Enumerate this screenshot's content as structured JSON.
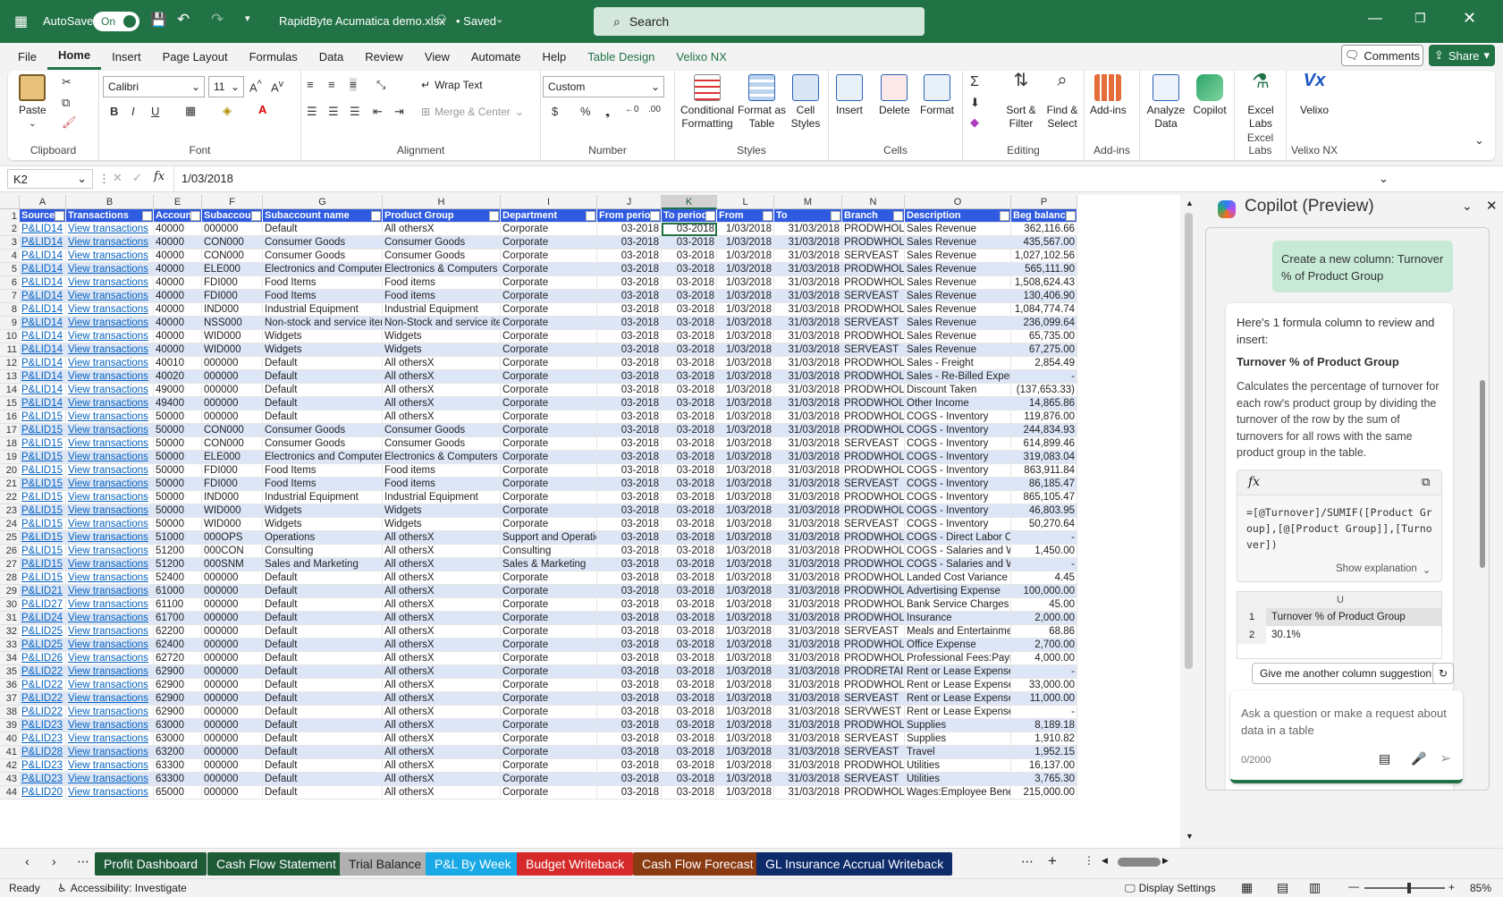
{
  "titlebar": {
    "autosave_label": "AutoSave",
    "toggle_label": "On",
    "filename": "RapidByte Acumatica demo.xlsx",
    "saved": "• Saved",
    "search_placeholder": "Search"
  },
  "menu": [
    "File",
    "Home",
    "Insert",
    "Page Layout",
    "Formulas",
    "Data",
    "Review",
    "View",
    "Automate",
    "Help",
    "Table Design",
    "Velixo NX"
  ],
  "menu_right": {
    "comments": "Comments",
    "share": "Share"
  },
  "ribbon": {
    "clipboard": {
      "paste": "Paste",
      "label": "Clipboard"
    },
    "font": {
      "name": "Calibri",
      "size": "11",
      "label": "Font"
    },
    "alignment": {
      "wrap": "Wrap Text",
      "merge": "Merge & Center",
      "label": "Alignment"
    },
    "number": {
      "format": "Custom",
      "label": "Number"
    },
    "styles": {
      "cond": "Conditional Formatting",
      "table": "Format as Table",
      "cell": "Cell Styles",
      "label": "Styles"
    },
    "cells": {
      "insert": "Insert",
      "delete": "Delete",
      "format": "Format",
      "label": "Cells"
    },
    "editing": {
      "sort": "Sort & Filter",
      "find": "Find & Select",
      "label": "Editing"
    },
    "addins": {
      "addins": "Add-ins",
      "label": "Add-ins"
    },
    "analyze": "Analyze Data",
    "copilot": "Copilot",
    "excellabs": {
      "btn": "Excel Labs",
      "label": "Excel Labs"
    },
    "velixo": {
      "btn": "Velixo",
      "label": "Velixo NX"
    }
  },
  "formula_bar": {
    "name_box": "K2",
    "fx": "fx",
    "value": "1/03/2018"
  },
  "columns": [
    "A",
    "B",
    "E",
    "F",
    "G",
    "H",
    "I",
    "J",
    "K",
    "L",
    "M",
    "N",
    "O",
    "P"
  ],
  "headers": [
    "Source",
    "Transactions",
    "Account",
    "Subaccount",
    "Subaccount name",
    "Product Group",
    "Department",
    "From period",
    "To period",
    "From",
    "To",
    "Branch",
    "Description",
    "Beg balance"
  ],
  "rows": [
    [
      "P&LID14",
      "View transactions",
      "40000",
      "000000",
      "Default",
      "All othersX",
      "Corporate",
      "03-2018",
      "03-2018",
      "1/03/2018",
      "31/03/2018",
      "PRODWHOLE",
      "Sales Revenue",
      "362,116.66"
    ],
    [
      "P&LID14",
      "View transactions",
      "40000",
      "CON000",
      "Consumer Goods",
      "Consumer Goods",
      "Corporate",
      "03-2018",
      "03-2018",
      "1/03/2018",
      "31/03/2018",
      "PRODWHOLE",
      "Sales Revenue",
      "435,567.00"
    ],
    [
      "P&LID14",
      "View transactions",
      "40000",
      "CON000",
      "Consumer Goods",
      "Consumer Goods",
      "Corporate",
      "03-2018",
      "03-2018",
      "1/03/2018",
      "31/03/2018",
      "SERVEAST",
      "Sales Revenue",
      "1,027,102.56"
    ],
    [
      "P&LID14",
      "View transactions",
      "40000",
      "ELE000",
      "Electronics and Computers",
      "Electronics & Computers",
      "Corporate",
      "03-2018",
      "03-2018",
      "1/03/2018",
      "31/03/2018",
      "PRODWHOLE",
      "Sales Revenue",
      "565,111.90"
    ],
    [
      "P&LID14",
      "View transactions",
      "40000",
      "FDI000",
      "Food Items",
      "Food items",
      "Corporate",
      "03-2018",
      "03-2018",
      "1/03/2018",
      "31/03/2018",
      "PRODWHOLE",
      "Sales Revenue",
      "1,508,624.43"
    ],
    [
      "P&LID14",
      "View transactions",
      "40000",
      "FDI000",
      "Food Items",
      "Food items",
      "Corporate",
      "03-2018",
      "03-2018",
      "1/03/2018",
      "31/03/2018",
      "SERVEAST",
      "Sales Revenue",
      "130,406.90"
    ],
    [
      "P&LID14",
      "View transactions",
      "40000",
      "IND000",
      "Industrial Equipment",
      "Industrial Equipment",
      "Corporate",
      "03-2018",
      "03-2018",
      "1/03/2018",
      "31/03/2018",
      "PRODWHOLE",
      "Sales Revenue",
      "1,084,774.74"
    ],
    [
      "P&LID14",
      "View transactions",
      "40000",
      "NSS000",
      "Non-stock and service iter",
      "Non-Stock and service ite",
      "Corporate",
      "03-2018",
      "03-2018",
      "1/03/2018",
      "31/03/2018",
      "SERVEAST",
      "Sales Revenue",
      "236,099.64"
    ],
    [
      "P&LID14",
      "View transactions",
      "40000",
      "WID000",
      "Widgets",
      "Widgets",
      "Corporate",
      "03-2018",
      "03-2018",
      "1/03/2018",
      "31/03/2018",
      "PRODWHOLE",
      "Sales Revenue",
      "65,735.00"
    ],
    [
      "P&LID14",
      "View transactions",
      "40000",
      "WID000",
      "Widgets",
      "Widgets",
      "Corporate",
      "03-2018",
      "03-2018",
      "1/03/2018",
      "31/03/2018",
      "SERVEAST",
      "Sales Revenue",
      "67,275.00"
    ],
    [
      "P&LID14",
      "View transactions",
      "40010",
      "000000",
      "Default",
      "All othersX",
      "Corporate",
      "03-2018",
      "03-2018",
      "1/03/2018",
      "31/03/2018",
      "PRODWHOLE",
      "Sales - Freight",
      "2,854.49"
    ],
    [
      "P&LID14",
      "View transactions",
      "40020",
      "000000",
      "Default",
      "All othersX",
      "Corporate",
      "03-2018",
      "03-2018",
      "1/03/2018",
      "31/03/2018",
      "PRODWHOLE",
      "Sales - Re-Billed Expen",
      "-"
    ],
    [
      "P&LID14",
      "View transactions",
      "49000",
      "000000",
      "Default",
      "All othersX",
      "Corporate",
      "03-2018",
      "03-2018",
      "1/03/2018",
      "31/03/2018",
      "PRODWHOLE",
      "Discount Taken",
      "(137,653.33)"
    ],
    [
      "P&LID14",
      "View transactions",
      "49400",
      "000000",
      "Default",
      "All othersX",
      "Corporate",
      "03-2018",
      "03-2018",
      "1/03/2018",
      "31/03/2018",
      "PRODWHOLE",
      "Other Income",
      "14,865.86"
    ],
    [
      "P&LID15",
      "View transactions",
      "50000",
      "000000",
      "Default",
      "All othersX",
      "Corporate",
      "03-2018",
      "03-2018",
      "1/03/2018",
      "31/03/2018",
      "PRODWHOLE",
      "COGS - Inventory",
      "119,876.00"
    ],
    [
      "P&LID15",
      "View transactions",
      "50000",
      "CON000",
      "Consumer Goods",
      "Consumer Goods",
      "Corporate",
      "03-2018",
      "03-2018",
      "1/03/2018",
      "31/03/2018",
      "PRODWHOLE",
      "COGS - Inventory",
      "244,834.93"
    ],
    [
      "P&LID15",
      "View transactions",
      "50000",
      "CON000",
      "Consumer Goods",
      "Consumer Goods",
      "Corporate",
      "03-2018",
      "03-2018",
      "1/03/2018",
      "31/03/2018",
      "SERVEAST",
      "COGS - Inventory",
      "614,899.46"
    ],
    [
      "P&LID15",
      "View transactions",
      "50000",
      "ELE000",
      "Electronics and Computers",
      "Electronics & Computers",
      "Corporate",
      "03-2018",
      "03-2018",
      "1/03/2018",
      "31/03/2018",
      "PRODWHOLE",
      "COGS - Inventory",
      "319,083.04"
    ],
    [
      "P&LID15",
      "View transactions",
      "50000",
      "FDI000",
      "Food Items",
      "Food items",
      "Corporate",
      "03-2018",
      "03-2018",
      "1/03/2018",
      "31/03/2018",
      "PRODWHOLE",
      "COGS - Inventory",
      "863,911.84"
    ],
    [
      "P&LID15",
      "View transactions",
      "50000",
      "FDI000",
      "Food Items",
      "Food items",
      "Corporate",
      "03-2018",
      "03-2018",
      "1/03/2018",
      "31/03/2018",
      "SERVEAST",
      "COGS - Inventory",
      "86,185.47"
    ],
    [
      "P&LID15",
      "View transactions",
      "50000",
      "IND000",
      "Industrial Equipment",
      "Industrial Equipment",
      "Corporate",
      "03-2018",
      "03-2018",
      "1/03/2018",
      "31/03/2018",
      "PRODWHOLE",
      "COGS - Inventory",
      "865,105.47"
    ],
    [
      "P&LID15",
      "View transactions",
      "50000",
      "WID000",
      "Widgets",
      "Widgets",
      "Corporate",
      "03-2018",
      "03-2018",
      "1/03/2018",
      "31/03/2018",
      "PRODWHOLE",
      "COGS - Inventory",
      "46,803.95"
    ],
    [
      "P&LID15",
      "View transactions",
      "50000",
      "WID000",
      "Widgets",
      "Widgets",
      "Corporate",
      "03-2018",
      "03-2018",
      "1/03/2018",
      "31/03/2018",
      "SERVEAST",
      "COGS - Inventory",
      "50,270.64"
    ],
    [
      "P&LID15",
      "View transactions",
      "51000",
      "000OPS",
      "Operations",
      "All othersX",
      "Support and Operatic",
      "03-2018",
      "03-2018",
      "1/03/2018",
      "31/03/2018",
      "PRODWHOLE",
      "COGS - Direct Labor Cos",
      "-"
    ],
    [
      "P&LID15",
      "View transactions",
      "51200",
      "000CON",
      "Consulting",
      "All othersX",
      "Consulting",
      "03-2018",
      "03-2018",
      "1/03/2018",
      "31/03/2018",
      "PRODWHOLE",
      "COGS - Salaries and Wa",
      "1,450.00"
    ],
    [
      "P&LID15",
      "View transactions",
      "51200",
      "000SNM",
      "Sales and Marketing",
      "All othersX",
      "Sales & Marketing",
      "03-2018",
      "03-2018",
      "1/03/2018",
      "31/03/2018",
      "PRODWHOLE",
      "COGS - Salaries and Wa",
      "-"
    ],
    [
      "P&LID15",
      "View transactions",
      "52400",
      "000000",
      "Default",
      "All othersX",
      "Corporate",
      "03-2018",
      "03-2018",
      "1/03/2018",
      "31/03/2018",
      "PRODWHOLE",
      "Landed Cost Variance",
      "4.45"
    ],
    [
      "P&LID21",
      "View transactions",
      "61000",
      "000000",
      "Default",
      "All othersX",
      "Corporate",
      "03-2018",
      "03-2018",
      "1/03/2018",
      "31/03/2018",
      "PRODWHOLE",
      "Advertising Expense",
      "100,000.00"
    ],
    [
      "P&LID27",
      "View transactions",
      "61100",
      "000000",
      "Default",
      "All othersX",
      "Corporate",
      "03-2018",
      "03-2018",
      "1/03/2018",
      "31/03/2018",
      "PRODWHOLE",
      "Bank Service Charges",
      "45.00"
    ],
    [
      "P&LID24",
      "View transactions",
      "61700",
      "000000",
      "Default",
      "All othersX",
      "Corporate",
      "03-2018",
      "03-2018",
      "1/03/2018",
      "31/03/2018",
      "PRODWHOLE",
      "Insurance",
      "2,000.00"
    ],
    [
      "P&LID25",
      "View transactions",
      "62200",
      "000000",
      "Default",
      "All othersX",
      "Corporate",
      "03-2018",
      "03-2018",
      "1/03/2018",
      "31/03/2018",
      "SERVEAST",
      "Meals and Entertainme",
      "68.86"
    ],
    [
      "P&LID25",
      "View transactions",
      "62400",
      "000000",
      "Default",
      "All othersX",
      "Corporate",
      "03-2018",
      "03-2018",
      "1/03/2018",
      "31/03/2018",
      "PRODWHOLE",
      "Office Expense",
      "2,700.00"
    ],
    [
      "P&LID26",
      "View transactions",
      "62720",
      "000000",
      "Default",
      "All othersX",
      "Corporate",
      "03-2018",
      "03-2018",
      "1/03/2018",
      "31/03/2018",
      "PRODWHOLE",
      "Professional Fees:Payr",
      "4,000.00"
    ],
    [
      "P&LID22",
      "View transactions",
      "62900",
      "000000",
      "Default",
      "All othersX",
      "Corporate",
      "03-2018",
      "03-2018",
      "1/03/2018",
      "31/03/2018",
      "PRODRETAIL",
      "Rent or Lease Expense",
      "-"
    ],
    [
      "P&LID22",
      "View transactions",
      "62900",
      "000000",
      "Default",
      "All othersX",
      "Corporate",
      "03-2018",
      "03-2018",
      "1/03/2018",
      "31/03/2018",
      "PRODWHOLE",
      "Rent or Lease Expense",
      "33,000.00"
    ],
    [
      "P&LID22",
      "View transactions",
      "62900",
      "000000",
      "Default",
      "All othersX",
      "Corporate",
      "03-2018",
      "03-2018",
      "1/03/2018",
      "31/03/2018",
      "SERVEAST",
      "Rent or Lease Expense",
      "11,000.00"
    ],
    [
      "P&LID22",
      "View transactions",
      "62900",
      "000000",
      "Default",
      "All othersX",
      "Corporate",
      "03-2018",
      "03-2018",
      "1/03/2018",
      "31/03/2018",
      "SERVWEST",
      "Rent or Lease Expense",
      "-"
    ],
    [
      "P&LID23",
      "View transactions",
      "63000",
      "000000",
      "Default",
      "All othersX",
      "Corporate",
      "03-2018",
      "03-2018",
      "1/03/2018",
      "31/03/2018",
      "PRODWHOLE",
      "Supplies",
      "8,189.18"
    ],
    [
      "P&LID23",
      "View transactions",
      "63000",
      "000000",
      "Default",
      "All othersX",
      "Corporate",
      "03-2018",
      "03-2018",
      "1/03/2018",
      "31/03/2018",
      "SERVEAST",
      "Supplies",
      "1,910.82"
    ],
    [
      "P&LID28",
      "View transactions",
      "63200",
      "000000",
      "Default",
      "All othersX",
      "Corporate",
      "03-2018",
      "03-2018",
      "1/03/2018",
      "31/03/2018",
      "SERVEAST",
      "Travel",
      "1,952.15"
    ],
    [
      "P&LID23",
      "View transactions",
      "63300",
      "000000",
      "Default",
      "All othersX",
      "Corporate",
      "03-2018",
      "03-2018",
      "1/03/2018",
      "31/03/2018",
      "PRODWHOLE",
      "Utilities",
      "16,137.00"
    ],
    [
      "P&LID23",
      "View transactions",
      "63300",
      "000000",
      "Default",
      "All othersX",
      "Corporate",
      "03-2018",
      "03-2018",
      "1/03/2018",
      "31/03/2018",
      "SERVEAST",
      "Utilities",
      "3,765.30"
    ],
    [
      "P&LID20",
      "View transactions",
      "65000",
      "000000",
      "Default",
      "All othersX",
      "Corporate",
      "03-2018",
      "03-2018",
      "1/03/2018",
      "31/03/2018",
      "PRODWHOLE",
      "Wages:Employee Bene",
      "215,000.00"
    ]
  ],
  "copilot": {
    "title": "Copilot (Preview)",
    "user_msg": "Create a new column: Turnover % of Product Group",
    "intro": "Here's 1 formula column to review and insert:",
    "col_title": "Turnover % of Product Group",
    "desc": "Calculates the percentage of turnover for each row's product group by dividing the turnover of the row by the sum of turnovers for all rows with the same product group in the table.",
    "formula": "=[@Turnover]/SUMIF([Product Group],[@[Product Group]],[Turnover])",
    "fx": "fx",
    "show_expl": "Show explanation",
    "preview_col": "U",
    "preview_rows": [
      [
        "1",
        "Turnover % of Product Group"
      ],
      [
        "2",
        "30.1%"
      ]
    ],
    "suggest_btn": "Give me another column suggestion",
    "ask_placeholder": "Ask a question or make a request about data in a table",
    "counter": "0/2000"
  },
  "sheets": [
    {
      "name": "Profit Dashboard",
      "color": "#1f5a37"
    },
    {
      "name": "Cash Flow Statement",
      "color": "#1f5a37"
    },
    {
      "name": "Trial Balance",
      "color": "#b0b0b0"
    },
    {
      "name": "P&L By Week",
      "color": "#19a9e6"
    },
    {
      "name": "Budget Writeback",
      "color": "#d62a2a"
    },
    {
      "name": "Cash Flow Forecast",
      "color": "#8a3b12"
    },
    {
      "name": "GL Insurance Accrual Writeback",
      "color": "#0e2b6a"
    }
  ],
  "status": {
    "ready": "Ready",
    "accessibility": "Accessibility: Investigate",
    "display": "Display Settings",
    "zoom": "85%"
  }
}
